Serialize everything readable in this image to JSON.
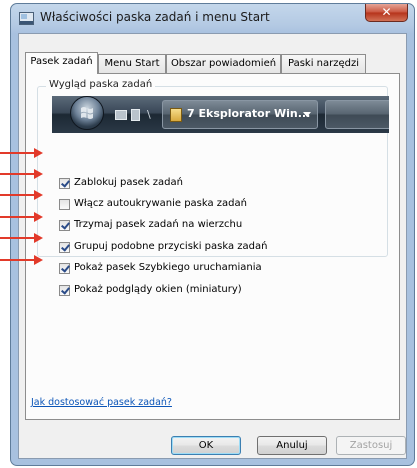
{
  "window": {
    "title": "Właściwości paska zadań i menu Start",
    "close_glyph": "✕"
  },
  "tabs": [
    {
      "label": "Pasek zadań",
      "active": true
    },
    {
      "label": "Menu Start",
      "active": false
    },
    {
      "label": "Obszar powiadomień",
      "active": false
    },
    {
      "label": "Paski narzędzi",
      "active": false
    }
  ],
  "appearance": {
    "group_label": "Wygląd paska zadań",
    "preview": {
      "taskbar_button_label": "7 Eksplorator Win...",
      "separator_glyph": "\\"
    }
  },
  "options": [
    {
      "label": "Zablokuj pasek zadań",
      "checked": true
    },
    {
      "label": "Włącz autoukrywanie paska zadań",
      "checked": false
    },
    {
      "label": "Trzymaj pasek zadań na wierzchu",
      "checked": true
    },
    {
      "label": "Grupuj podobne przyciski paska zadań",
      "checked": true
    },
    {
      "label": "Pokaż pasek Szybkiego uruchamiania",
      "checked": true
    },
    {
      "label": "Pokaż podglądy okien (miniatury)",
      "checked": true
    }
  ],
  "help_link": "Jak dostosować pasek zadań?",
  "buttons": {
    "ok": "OK",
    "cancel": "Anuluj",
    "apply": "Zastosuj"
  },
  "colors": {
    "annotation_arrow": "#e23a2a",
    "link": "#0b55b8",
    "title_bar": "#b3c9e3"
  }
}
